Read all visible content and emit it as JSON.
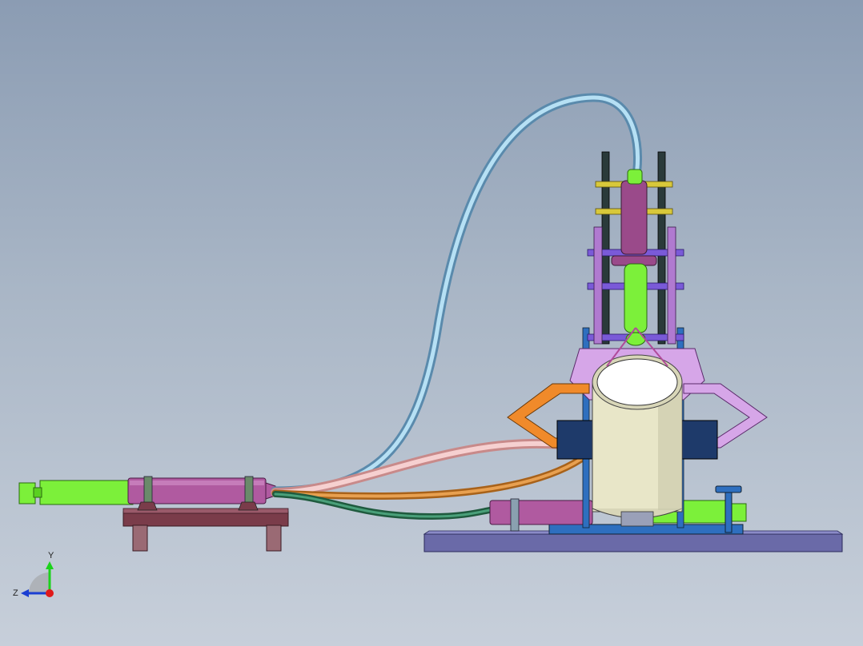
{
  "viewport": {
    "background_top": "#8b9cb3",
    "background_bottom": "#c7cfda"
  },
  "triad": {
    "x_label": "",
    "y_label": "Y",
    "z_label": "Z",
    "y_color": "#1bd21b",
    "z_color": "#1b3fd2",
    "origin_color": "#e01a1a"
  },
  "model": {
    "colors": {
      "syringe_green": "#7cf03a",
      "syringe_body": "#b05aa0",
      "base_plate": "#6a6aa8",
      "bracket_plate": "#7a3c4a",
      "tube_blue": "#8ec8e8",
      "tube_pink": "#f2b8b8",
      "tube_orange": "#d98a2a",
      "tube_green": "#2f7f5a",
      "cylinder": "#e8e6c8",
      "frame_lavender": "#d6a6e8",
      "frame_orange": "#f08a2a",
      "rail_dark": "#2a3a3a",
      "clamp_navy": "#1e3a6a",
      "rod_yellow": "#d8c83a",
      "rod_purple": "#7a5ad8"
    }
  }
}
